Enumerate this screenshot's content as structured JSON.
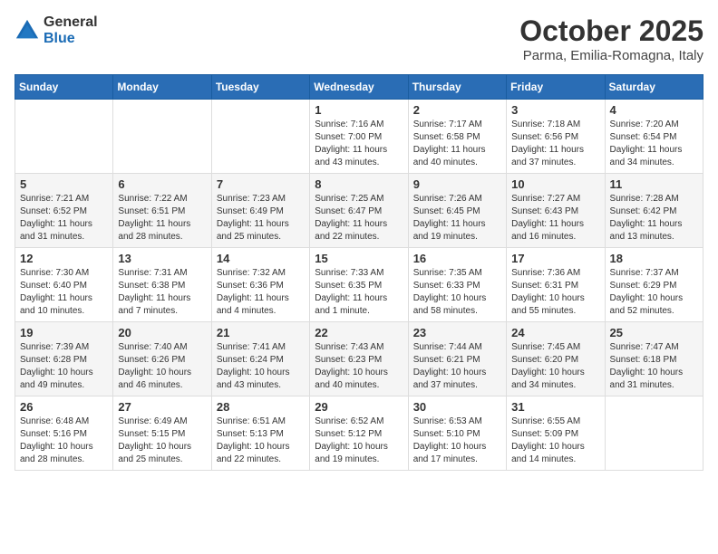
{
  "header": {
    "logo": {
      "general": "General",
      "blue": "Blue"
    },
    "title": "October 2025",
    "location": "Parma, Emilia-Romagna, Italy"
  },
  "calendar": {
    "days_of_week": [
      "Sunday",
      "Monday",
      "Tuesday",
      "Wednesday",
      "Thursday",
      "Friday",
      "Saturday"
    ],
    "weeks": [
      [
        {
          "day": "",
          "info": ""
        },
        {
          "day": "",
          "info": ""
        },
        {
          "day": "",
          "info": ""
        },
        {
          "day": "1",
          "info": "Sunrise: 7:16 AM\nSunset: 7:00 PM\nDaylight: 11 hours and 43 minutes."
        },
        {
          "day": "2",
          "info": "Sunrise: 7:17 AM\nSunset: 6:58 PM\nDaylight: 11 hours and 40 minutes."
        },
        {
          "day": "3",
          "info": "Sunrise: 7:18 AM\nSunset: 6:56 PM\nDaylight: 11 hours and 37 minutes."
        },
        {
          "day": "4",
          "info": "Sunrise: 7:20 AM\nSunset: 6:54 PM\nDaylight: 11 hours and 34 minutes."
        }
      ],
      [
        {
          "day": "5",
          "info": "Sunrise: 7:21 AM\nSunset: 6:52 PM\nDaylight: 11 hours and 31 minutes."
        },
        {
          "day": "6",
          "info": "Sunrise: 7:22 AM\nSunset: 6:51 PM\nDaylight: 11 hours and 28 minutes."
        },
        {
          "day": "7",
          "info": "Sunrise: 7:23 AM\nSunset: 6:49 PM\nDaylight: 11 hours and 25 minutes."
        },
        {
          "day": "8",
          "info": "Sunrise: 7:25 AM\nSunset: 6:47 PM\nDaylight: 11 hours and 22 minutes."
        },
        {
          "day": "9",
          "info": "Sunrise: 7:26 AM\nSunset: 6:45 PM\nDaylight: 11 hours and 19 minutes."
        },
        {
          "day": "10",
          "info": "Sunrise: 7:27 AM\nSunset: 6:43 PM\nDaylight: 11 hours and 16 minutes."
        },
        {
          "day": "11",
          "info": "Sunrise: 7:28 AM\nSunset: 6:42 PM\nDaylight: 11 hours and 13 minutes."
        }
      ],
      [
        {
          "day": "12",
          "info": "Sunrise: 7:30 AM\nSunset: 6:40 PM\nDaylight: 11 hours and 10 minutes."
        },
        {
          "day": "13",
          "info": "Sunrise: 7:31 AM\nSunset: 6:38 PM\nDaylight: 11 hours and 7 minutes."
        },
        {
          "day": "14",
          "info": "Sunrise: 7:32 AM\nSunset: 6:36 PM\nDaylight: 11 hours and 4 minutes."
        },
        {
          "day": "15",
          "info": "Sunrise: 7:33 AM\nSunset: 6:35 PM\nDaylight: 11 hours and 1 minute."
        },
        {
          "day": "16",
          "info": "Sunrise: 7:35 AM\nSunset: 6:33 PM\nDaylight: 10 hours and 58 minutes."
        },
        {
          "day": "17",
          "info": "Sunrise: 7:36 AM\nSunset: 6:31 PM\nDaylight: 10 hours and 55 minutes."
        },
        {
          "day": "18",
          "info": "Sunrise: 7:37 AM\nSunset: 6:29 PM\nDaylight: 10 hours and 52 minutes."
        }
      ],
      [
        {
          "day": "19",
          "info": "Sunrise: 7:39 AM\nSunset: 6:28 PM\nDaylight: 10 hours and 49 minutes."
        },
        {
          "day": "20",
          "info": "Sunrise: 7:40 AM\nSunset: 6:26 PM\nDaylight: 10 hours and 46 minutes."
        },
        {
          "day": "21",
          "info": "Sunrise: 7:41 AM\nSunset: 6:24 PM\nDaylight: 10 hours and 43 minutes."
        },
        {
          "day": "22",
          "info": "Sunrise: 7:43 AM\nSunset: 6:23 PM\nDaylight: 10 hours and 40 minutes."
        },
        {
          "day": "23",
          "info": "Sunrise: 7:44 AM\nSunset: 6:21 PM\nDaylight: 10 hours and 37 minutes."
        },
        {
          "day": "24",
          "info": "Sunrise: 7:45 AM\nSunset: 6:20 PM\nDaylight: 10 hours and 34 minutes."
        },
        {
          "day": "25",
          "info": "Sunrise: 7:47 AM\nSunset: 6:18 PM\nDaylight: 10 hours and 31 minutes."
        }
      ],
      [
        {
          "day": "26",
          "info": "Sunrise: 6:48 AM\nSunset: 5:16 PM\nDaylight: 10 hours and 28 minutes."
        },
        {
          "day": "27",
          "info": "Sunrise: 6:49 AM\nSunset: 5:15 PM\nDaylight: 10 hours and 25 minutes."
        },
        {
          "day": "28",
          "info": "Sunrise: 6:51 AM\nSunset: 5:13 PM\nDaylight: 10 hours and 22 minutes."
        },
        {
          "day": "29",
          "info": "Sunrise: 6:52 AM\nSunset: 5:12 PM\nDaylight: 10 hours and 19 minutes."
        },
        {
          "day": "30",
          "info": "Sunrise: 6:53 AM\nSunset: 5:10 PM\nDaylight: 10 hours and 17 minutes."
        },
        {
          "day": "31",
          "info": "Sunrise: 6:55 AM\nSunset: 5:09 PM\nDaylight: 10 hours and 14 minutes."
        },
        {
          "day": "",
          "info": ""
        }
      ]
    ]
  }
}
